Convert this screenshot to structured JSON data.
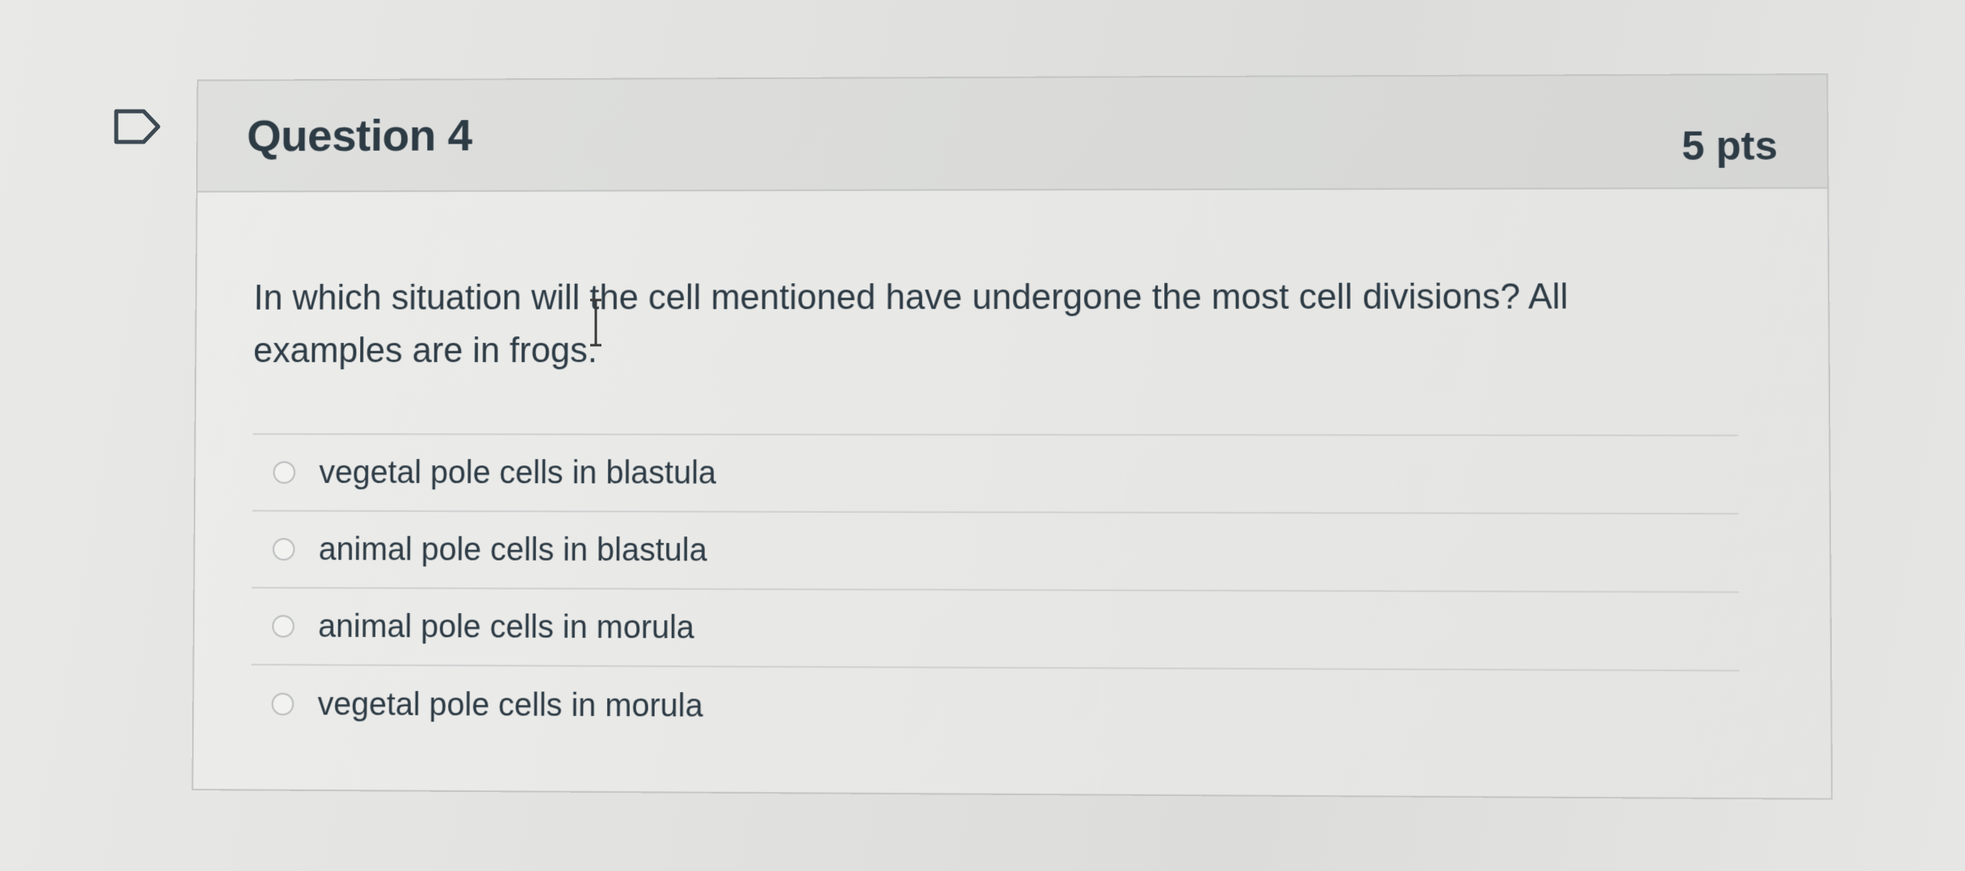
{
  "question": {
    "title": "Question 4",
    "points": "5 pts",
    "text": "In which situation will the cell mentioned have undergone the most cell divisions?  All examples are in frogs.",
    "flag_icon": "bookmark-flag-icon",
    "answers": [
      {
        "label": "vegetal pole cells in blastula",
        "selected": false
      },
      {
        "label": "animal pole cells in blastula",
        "selected": false
      },
      {
        "label": "animal pole cells in morula",
        "selected": false
      },
      {
        "label": "vegetal pole cells in morula",
        "selected": false
      }
    ]
  },
  "colors": {
    "text": "#2d3b45",
    "border": "#c4c6c6",
    "header_bg": "#dcdddb"
  }
}
